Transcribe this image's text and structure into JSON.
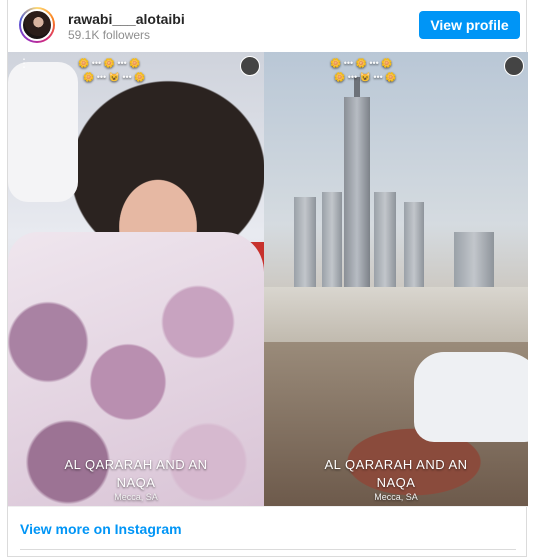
{
  "header": {
    "username": "rawabi___alotaibi",
    "followers": "59.1K followers",
    "view_profile_label": "View profile"
  },
  "media": {
    "left_panel": {
      "caption_line1": "AL QARARAH AND AN",
      "caption_line2": "NAQA",
      "location": "Mecca, SA"
    },
    "right_panel": {
      "caption_line1": "AL QARARAH AND AN",
      "caption_line2": "NAQA",
      "location": "Mecca, SA"
    }
  },
  "footer": {
    "view_more_label": "View more on Instagram"
  },
  "colors": {
    "accent": "#0095f6",
    "text_primary": "#262626",
    "text_secondary": "#8e8e8e"
  }
}
